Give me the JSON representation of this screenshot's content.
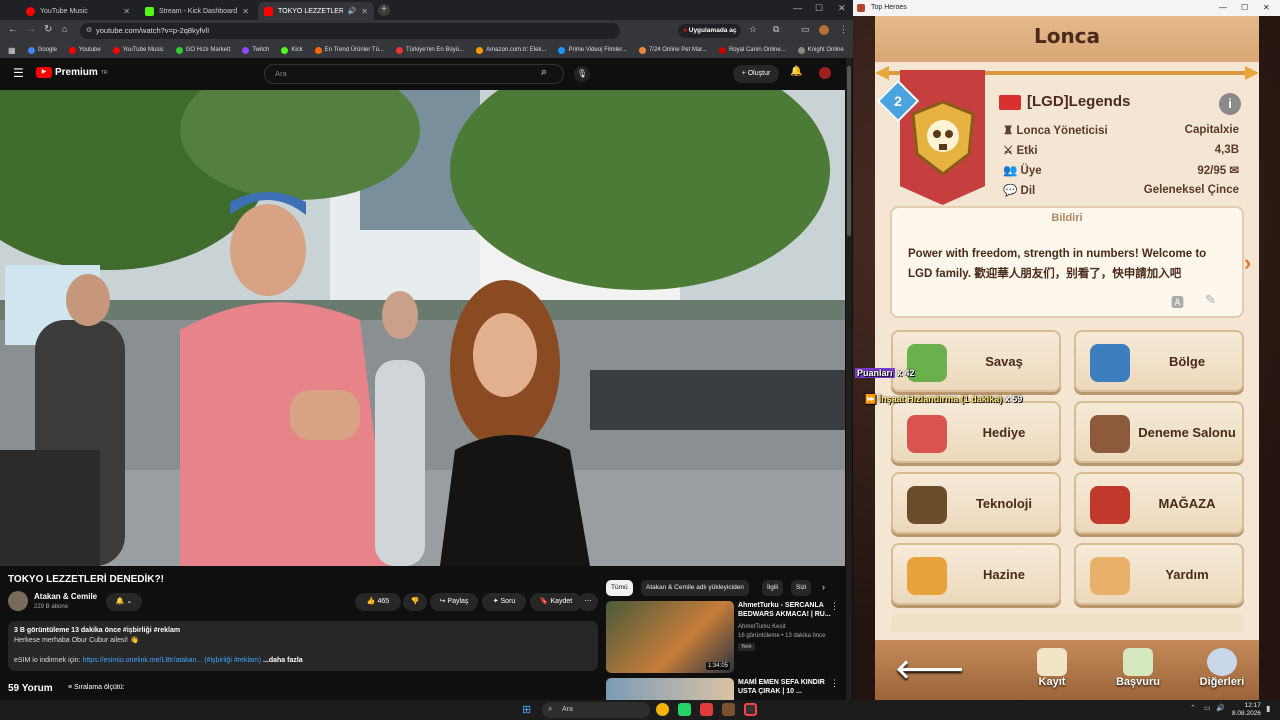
{
  "browser": {
    "tabs": [
      {
        "title": "YouTube Music"
      },
      {
        "title": "Stream - Kick Dashboard"
      },
      {
        "title": "TOKYO LEZZETLERİ DENEDİ"
      }
    ],
    "url": "youtube.com/watch?v=p-2q8kyfvlI",
    "app_pill": "Uygulamada aç",
    "bookmarks": [
      "Google",
      "Youtube",
      "YouTube Music",
      "GO Hızlı Markett",
      "Twitch",
      "Kick",
      "En Trend Ürünler Tü...",
      "Türkiye'nin En Büyü...",
      "Amazon.com.tr: Elek...",
      "Prime Video| Filmler...",
      "7/24 Online Pet Mar...",
      "Royal Canin Online...",
      "Knight Online"
    ]
  },
  "youtube": {
    "logo_text": "Premium",
    "logo_sup": "TR",
    "search_placeholder": "Ara",
    "create_label": "Oluştur",
    "video_title": "TOKYO LEZZETLERİ DENEDİK?!",
    "channel_name": "Atakan & Cemile",
    "subscribers": "229 B abone",
    "likes": "465",
    "share_label": "Paylaş",
    "ask_label": "Soru",
    "save_label": "Kaydet",
    "desc_line1": "3 B görüntüleme  13 dakika önce  #işbirliği #reklam",
    "desc_line2": "Herkese merhaba Obur Cubur ailesi! 👋",
    "desc_line3_prefix": "eSIM io indirmek için: ",
    "desc_link": "https://esimio.onelink.me/L8tr/atakan...",
    "desc_tags": "(#işbirliği #reklam)",
    "desc_more": "...daha fazla",
    "comments_count": "59 Yorum",
    "sort_label": "Sıralama ölçütü:",
    "chips": [
      "Tümü",
      "Atakan & Cemile adlı yükleyiciden",
      "İlgili",
      "Sizi"
    ],
    "rec1": {
      "title": "AhmetTurku - SERCANLA BEDWARS AKMACA! | RU...",
      "channel": "AhmetTurku Kesit",
      "meta": "16 görüntüleme • 13 dakika önce",
      "badge": "Yeni",
      "duration": "1:34:05"
    },
    "rec2": {
      "title": "MAMİ EMEN SEFA KINDIR USTA ÇIRAK | 10 ..."
    }
  },
  "game": {
    "window_title": "Top Heroes",
    "page_title": "Lonca",
    "level": "2",
    "guild_name": "[LGD]Legends",
    "info": [
      {
        "label": "Lonca Yöneticisi",
        "value": "Capitalxie"
      },
      {
        "label": "Etki",
        "value": "4,3B"
      },
      {
        "label": "Üye",
        "value": "92/95"
      },
      {
        "label": "Dil",
        "value": "Geleneksel Çince"
      }
    ],
    "notice_header": "Bildiri",
    "notice_text": "Power with freedom, strength in numbers! Welcome to LGD family. 歡迎華人朋友们，别看了，快申請加入吧",
    "buttons": [
      {
        "label": "Savaş",
        "color": "#6ab04c"
      },
      {
        "label": "Bölge",
        "color": "#3d7ebf"
      },
      {
        "label": "Hediye",
        "color": "#d9534f"
      },
      {
        "label": "Deneme Salonu",
        "color": "#8d5a3b"
      },
      {
        "label": "Teknoloji",
        "color": "#6b4b2a"
      },
      {
        "label": "MAĞAZA",
        "color": "#c0392b"
      },
      {
        "label": "Hazine",
        "color": "#e6a23c"
      },
      {
        "label": "Yardım",
        "color": "#e8b06b"
      }
    ],
    "overlay_points": "Puanları",
    "overlay_points_count": "x 42",
    "overlay_speedup": "İnşaat Hızlandırma (1 dakika)",
    "overlay_speedup_count": "x 59",
    "bottom": [
      {
        "label": "Kayıt"
      },
      {
        "label": "Başvuru"
      },
      {
        "label": "Diğerleri"
      }
    ]
  },
  "taskbar": {
    "search": "Ara",
    "time": "12:17",
    "date": "8.08.2026"
  },
  "colors": {
    "yt_red": "#ff0000",
    "game_title": "#4a2a1a",
    "banner_red": "#c73e3e"
  }
}
